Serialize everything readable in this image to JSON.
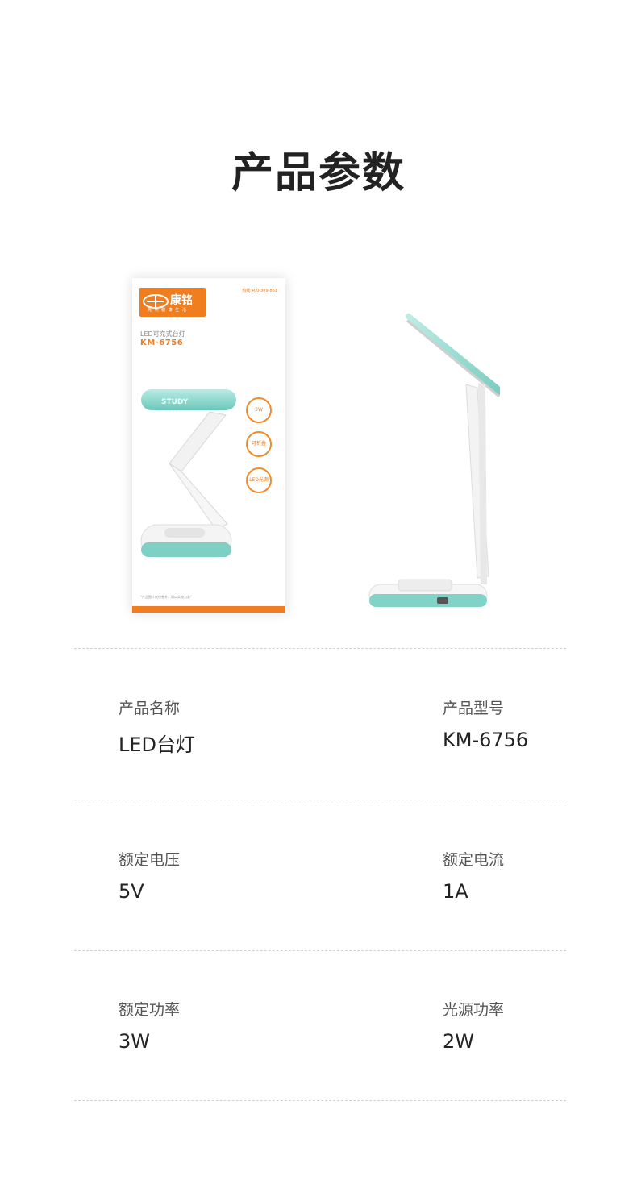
{
  "title": "产品参数",
  "box": {
    "brand": "康铭",
    "brand_sub": "光 明 健 康 生 活",
    "hotline": "热线:400-309-861",
    "product_name": "LED可充式台灯",
    "model": "KM-6756",
    "lamp_text": "STUDY",
    "badges": [
      "3W",
      "可折叠",
      "LED光源"
    ],
    "note": "*产品图片仅供参考，请以实物为准*"
  },
  "specs": [
    {
      "label": "产品名称",
      "value": "LED台灯"
    },
    {
      "label": "产品型号",
      "value": "KM-6756"
    },
    {
      "label": "额定电压",
      "value": "5V"
    },
    {
      "label": "额定电流",
      "value": "1A"
    },
    {
      "label": "额定功率",
      "value": "3W"
    },
    {
      "label": "光源功率",
      "value": "2W"
    }
  ],
  "colors": {
    "brand_orange": "#f07d1e",
    "lamp_teal": "#8fd8cf",
    "divider": "#d3d3d3"
  }
}
